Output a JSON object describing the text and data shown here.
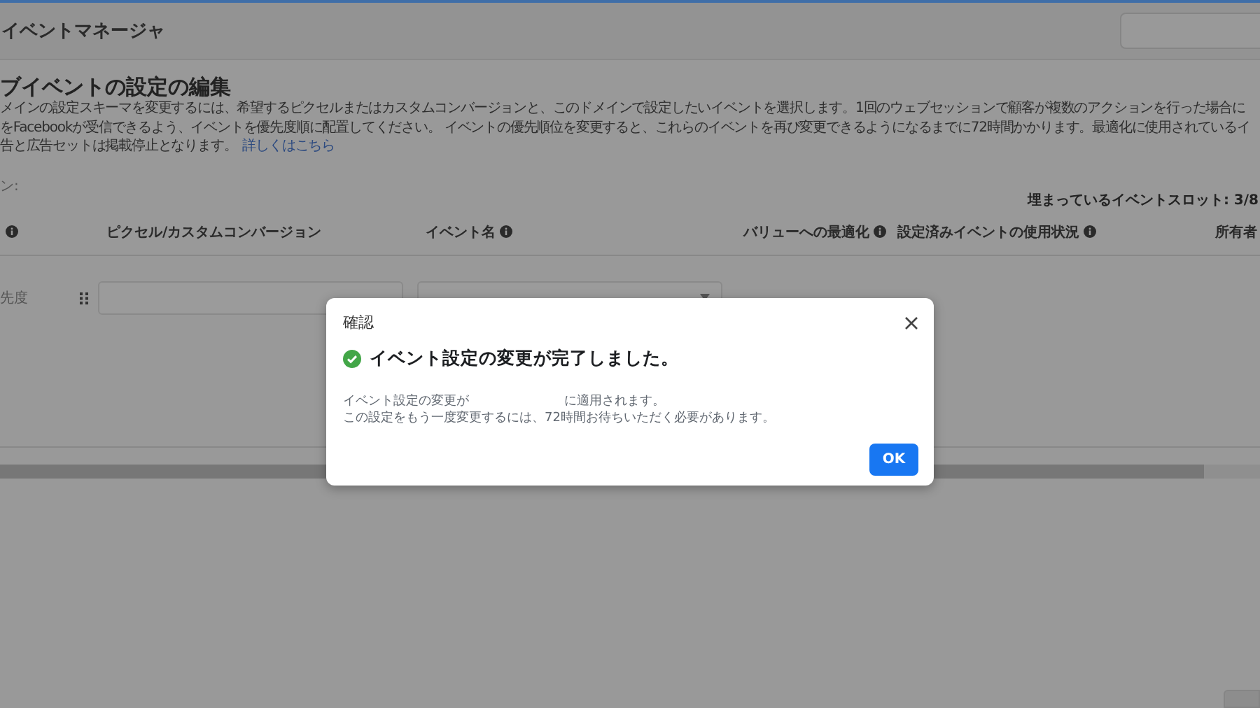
{
  "header": {
    "title": "イベントマネージャ",
    "search_field": true
  },
  "section": {
    "title": "ブイベントの設定の編集",
    "description": [
      "メインの設定スキーマを変更するには、希望するピクセルまたはカスタムコンバージョンと、このドメインで設定したいイベントを選択します。1回のウェブセッションで顧客が複数のアクションを行った場合に",
      "をFacebookが受信できるよう、イベントを優先度順に配置してください。 イベントの優先順位を変更すると、これらのイベントを再び変更できるようになるまでに72時間かかります。最適化に使用されているイ",
      "告と広告セットは掲載停止となります。"
    ],
    "link": "詳しくはこちら",
    "domain_label": "ン:",
    "slots": "埋まっているイベントスロット: 3/8"
  },
  "table": {
    "columns": [
      {
        "info": true
      },
      {
        "label": "ピクセル/カスタムコンバージョン",
        "info": false
      },
      {
        "label": "イベント名",
        "info": true
      },
      {
        "label": "バリューへの最適化",
        "info": true
      },
      {
        "label": "設定済みイベントの使用状況",
        "info": true
      },
      {
        "label": "所有者",
        "info": false
      }
    ],
    "rows": [
      {
        "priority": "先度"
      }
    ]
  },
  "dialog": {
    "title": "確認",
    "heading": "イベント設定の変更が完了しました。",
    "body_start": "イベント設定の変更が",
    "body_end": "に適用されます。",
    "body_line2": "この設定をもう一度変更するには、72時間お待ちいただく必要があります。",
    "ok": "OK"
  }
}
